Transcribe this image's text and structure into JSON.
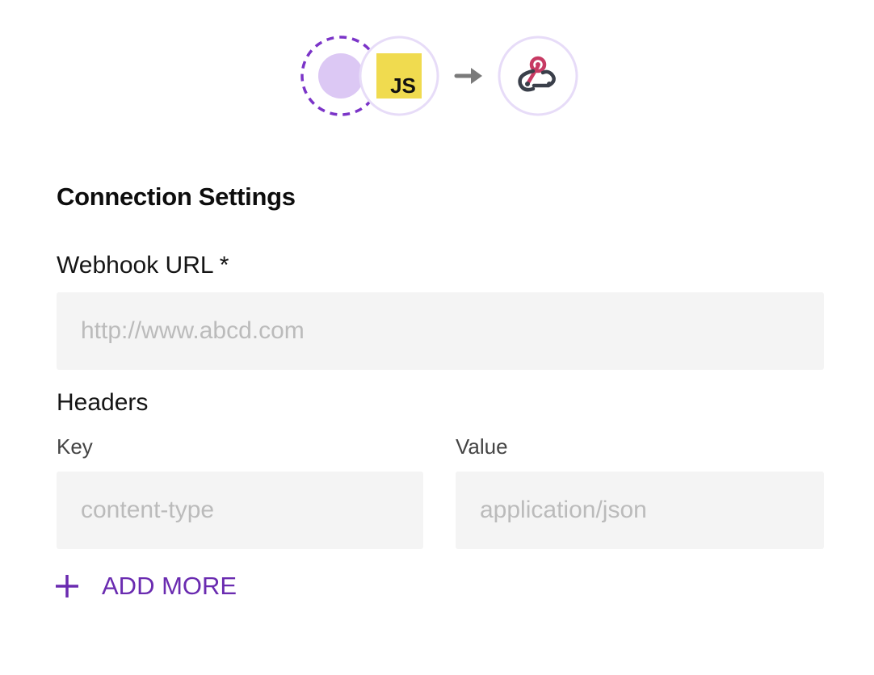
{
  "flow": {
    "source_icon": "placeholder-circle-icon",
    "transform_icon": "javascript-icon",
    "transform_text": "JS",
    "arrow_icon": "arrow-right-icon",
    "destination_icon": "webhook-icon"
  },
  "connection": {
    "title": "Connection Settings",
    "webhook_label": "Webhook URL *",
    "webhook_placeholder": "http://www.abcd.com",
    "headers_label": "Headers",
    "key_label": "Key",
    "value_label": "Value",
    "key_placeholder": "content-type",
    "value_placeholder": "application/json",
    "add_more_label": "ADD MORE"
  },
  "colors": {
    "accent": "#6a2bb0",
    "circle_border": "#e7dcf8",
    "source_fill": "#dcc8f4",
    "js_yellow": "#f0db4f",
    "input_bg": "#f4f4f4"
  }
}
